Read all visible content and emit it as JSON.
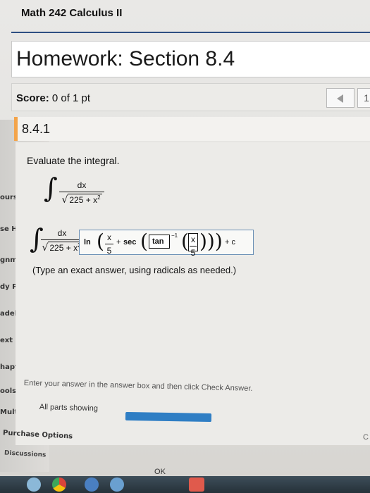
{
  "header": {
    "course_title": "Math 242 Calculus II",
    "homework_title": "Homework: Section 8.4"
  },
  "score": {
    "label": "Score:",
    "value": "0 of 1 pt"
  },
  "question": {
    "number": "8.4.1",
    "prompt": "Evaluate the integral.",
    "integral": {
      "symbol": "∫",
      "numerator": "dx",
      "denominator_radicand": "225 + x",
      "exponent": "2"
    },
    "answer": {
      "equals": "=",
      "ln": "ln",
      "x_over_5_num": "x",
      "x_over_5_den": "5",
      "plus": "+",
      "sec": "sec",
      "tan": "tan",
      "inverse": "−1",
      "constant": "+ c"
    },
    "hint": "(Type an exact answer, using radicals as needed.)"
  },
  "sidebar": {
    "items": [
      "ours",
      "se H",
      "gnme",
      "dy Pla",
      "adeboo",
      "ext",
      "hapter",
      "ools for",
      "Multimed",
      "Purchase Options",
      "Discussions"
    ]
  },
  "footer": {
    "instruction": "Enter your answer in the answer box and then click Check Answer.",
    "parts_label": "All parts showing",
    "progress": 1.0,
    "ok_label": "OK"
  },
  "navigation": {
    "prev_icon": "triangle-left-icon",
    "next_label": "1"
  },
  "colors": {
    "accent": "#2d4e82",
    "question_marker": "#f3a44a",
    "progress": "#2f7ec4"
  }
}
